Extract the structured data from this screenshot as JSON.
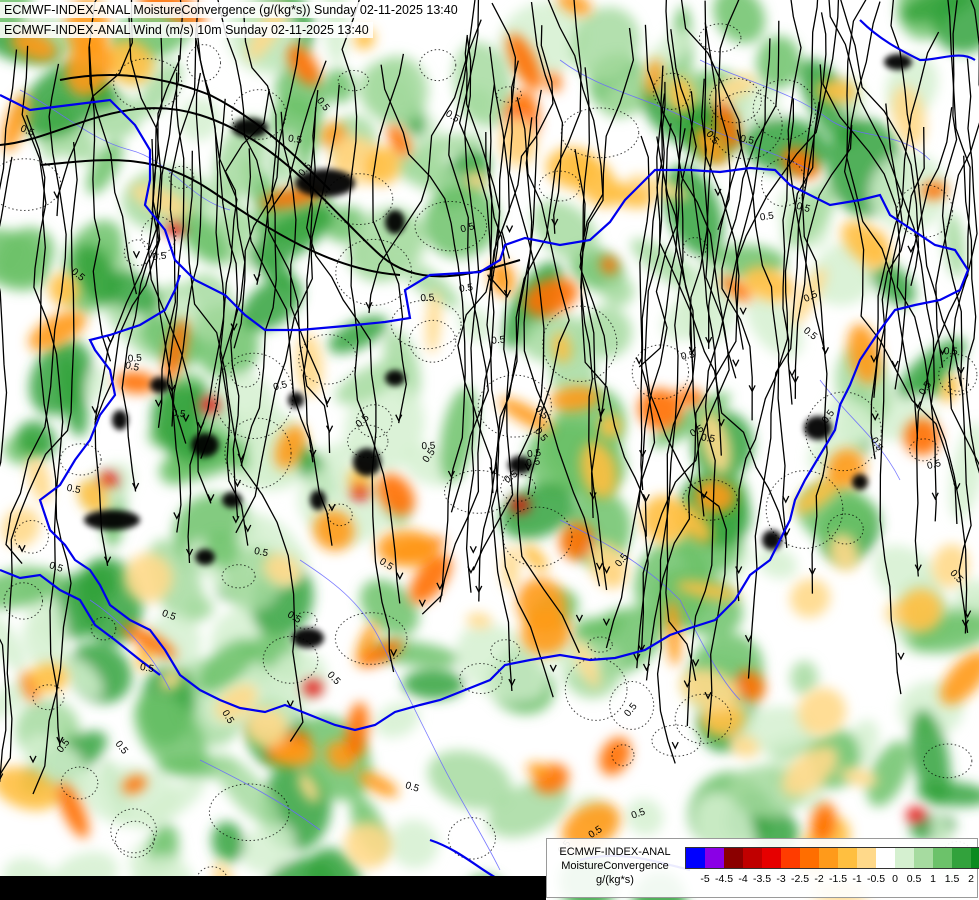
{
  "header": {
    "title_line_1": "ECMWF-INDEX-ANAL MoistureConvergence (g/(kg*s)) Sunday 02-11-2025 13:40",
    "title_line_2": "ECMWF-INDEX-ANAL Wind (m/s) 10m Sunday 02-11-2025 13:40"
  },
  "legend": {
    "title_lines": [
      "ECMWF-INDEX-ANAL",
      "MoistureConvergence",
      "g/(kg*s)"
    ],
    "colors": [
      "#0000ff",
      "#8a00e6",
      "#8b0000",
      "#c00000",
      "#e60000",
      "#ff3c00",
      "#ff6e00",
      "#ff9a1a",
      "#ffbf40",
      "#ffd98a",
      "#ffffff",
      "#d5f0d0",
      "#a6dba0",
      "#6cc26a",
      "#32a23c",
      "#0a8a1e"
    ],
    "ticks": [
      "-5",
      "-4.5",
      "-4",
      "-3.5",
      "-3",
      "-2.5",
      "-2",
      "-1.5",
      "-1",
      "-0.5",
      "0",
      "0.5",
      "1",
      "1.5",
      "2"
    ]
  },
  "map": {
    "contour_label": "0.5",
    "colors": {
      "border": "#0000ee",
      "rivers": "#6a6aff",
      "streamlines": "#000000",
      "strong_convergence": "#000000"
    }
  }
}
